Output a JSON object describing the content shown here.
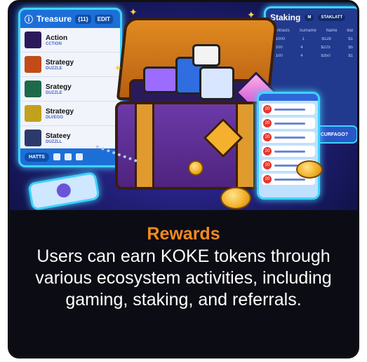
{
  "caption": {
    "title": "Rewards",
    "body": "Users can earn KOKE tokens through various ecosystem activities, including gaming, staking, and referrals."
  },
  "illustration": {
    "left_panel": {
      "title": "Treasure",
      "title_icon": "info-icon",
      "header_chip_1": "{11}",
      "header_chip_2": "EDIT",
      "items": [
        {
          "title": "Action",
          "subtitle": "CCTION",
          "thumb_color": "#2b1a5a"
        },
        {
          "title": "Strategy",
          "subtitle": "DUZZLE",
          "thumb_color": "#c24b18"
        },
        {
          "title": "Srategy",
          "subtitle": "DUZZLE",
          "thumb_color": "#1c6a4a"
        },
        {
          "title": "Strategy",
          "subtitle": "DLVEGO",
          "thumb_color": "#c2a11e"
        },
        {
          "title": "Stateey",
          "subtitle": "DUZZLL",
          "thumb_color": "#2b3a6a"
        }
      ],
      "footer_button": "HATTS"
    },
    "right_panel": {
      "title": "Staking",
      "chip_1": "M",
      "chip_2": "STAKLATT",
      "header_row": [
        "Contracts",
        "Surname",
        "Name",
        "Bal"
      ],
      "rows": [
        [
          "S 1000",
          "1",
          "$128",
          "$1"
        ],
        [
          "S 100",
          "4",
          "$225",
          "$5"
        ],
        [
          "S 100",
          "4",
          "$350",
          "$1"
        ]
      ],
      "cta": "ZY CURFAGO?"
    },
    "phone_badges": [
      "20",
      "20",
      "20",
      "20",
      "20",
      "20"
    ]
  }
}
